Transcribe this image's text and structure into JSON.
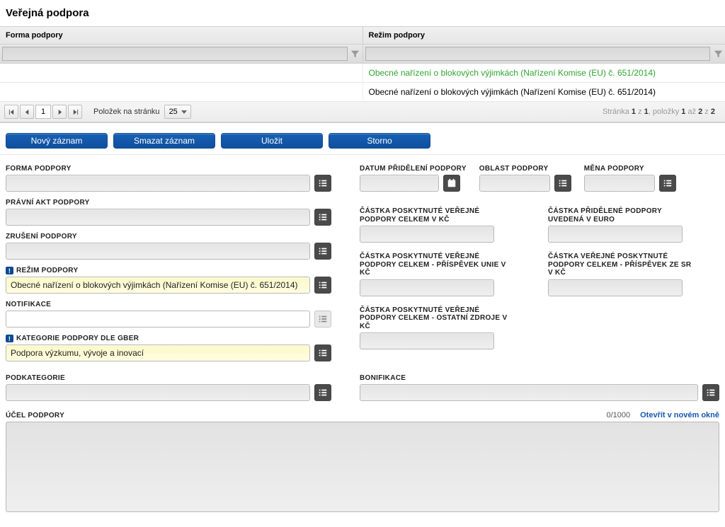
{
  "title": "Veřejná podpora",
  "grid": {
    "col1": "Forma podpory",
    "col2": "Režim podpory",
    "rows": [
      {
        "c1": "",
        "c2": "Obecné nařízení o blokových výjimkách (Nařízení Komise (EU) č. 651/2014)"
      },
      {
        "c1": "",
        "c2": "Obecné nařízení o blokových výjimkách (Nařízení Komise (EU) č. 651/2014)"
      }
    ]
  },
  "pager": {
    "page": "1",
    "perpage_label": "Položek na stránku",
    "perpage": "25",
    "info_pre": "Stránka ",
    "info_page": "1",
    "info_mid": " z ",
    "info_total": "1",
    "info_items_pre": ", položky ",
    "info_from": "1",
    "info_az": " až ",
    "info_to": "2",
    "info_z": " z ",
    "info_count": "2"
  },
  "buttons": {
    "novy": "Nový záznam",
    "smazat": "Smazat záznam",
    "ulozit": "Uložit",
    "storno": "Storno"
  },
  "form": {
    "forma_podpory": "FORMA PODPORY",
    "pravni_akt": "PRÁVNÍ AKT PODPORY",
    "zruseni": "ZRUŠENÍ PODPORY",
    "rezim": "REŽIM PODPORY",
    "rezim_val": "Obecné nařízení o blokových výjimkách (Nařízení Komise (EU) č. 651/2014)",
    "notifikace": "NOTIFIKACE",
    "kategorie": "KATEGORIE PODPORY DLE GBER",
    "kategorie_val": "Podpora výzkumu, vývoje a inovací",
    "podkategorie": "PODKATEGORIE",
    "datum": "DATUM PŘIDĚLENÍ PODPORY",
    "oblast": "OBLAST PODPORY",
    "mena": "MĚNA PODPORY",
    "celkem_kc": "ČÁSTKA POSKYTNUTÉ VEŘEJNÉ PODPORY CELKEM V KČ",
    "pridelena_euro": "ČÁSTKA PŘIDĚLENÉ PODPORY UVEDENÁ V EURO",
    "unie_kc": "ČÁSTKA POSKYTNUTÉ VEŘEJNÉ PODPORY CELKEM - PŘÍSPĚVEK UNIE V KČ",
    "sr_kc": "ČÁSTKA VEŘEJNÉ POSKYTNUTÉ PODPORY CELKEM - PŘÍSPĚVEK ZE SR V KČ",
    "ostatni_kc": "ČÁSTKA POSKYTNUTÉ VEŘEJNÉ PODPORY CELKEM - OSTATNÍ ZDROJE V KČ",
    "bonifikace": "BONIFIKACE",
    "ucel": "ÚČEL PODPORY",
    "counter": "0/1000",
    "openwin": "Otevřít v novém okně"
  }
}
